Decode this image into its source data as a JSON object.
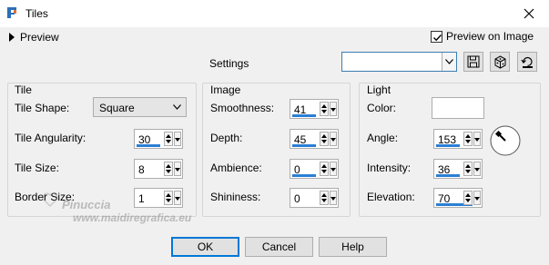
{
  "window": {
    "title": "Tiles",
    "close_icon": "close-icon",
    "app_icon": "paint-shop-pro-icon"
  },
  "top": {
    "preview_toggle": "Preview",
    "preview_on_image": "Preview on Image",
    "preview_on_image_checked": true,
    "settings_label": "Settings",
    "settings_value": ""
  },
  "tile": {
    "title": "Tile",
    "shape_label": "Tile Shape:",
    "shape_value": "Square",
    "angularity_label": "Tile Angularity:",
    "angularity_value": "30",
    "size_label": "Tile Size:",
    "size_value": "8",
    "border_label": "Border Size:",
    "border_value": "1"
  },
  "image": {
    "title": "Image",
    "smoothness_label": "Smoothness:",
    "smoothness_value": "41",
    "depth_label": "Depth:",
    "depth_value": "45",
    "ambience_label": "Ambience:",
    "ambience_value": "0",
    "shininess_label": "Shininess:",
    "shininess_value": "0"
  },
  "light": {
    "title": "Light",
    "color_label": "Color:",
    "color_value": "#ffffff",
    "angle_label": "Angle:",
    "angle_value": "153",
    "intensity_label": "Intensity:",
    "intensity_value": "36",
    "elevation_label": "Elevation:",
    "elevation_value": "70"
  },
  "buttons": {
    "ok": "OK",
    "cancel": "Cancel",
    "help": "Help"
  },
  "watermark": {
    "line1": "Pinuccia",
    "line2": "www.maidiregrafica.eu"
  },
  "colors": {
    "accent": "#0078d7",
    "spin_underline": "#2a7fd4"
  }
}
